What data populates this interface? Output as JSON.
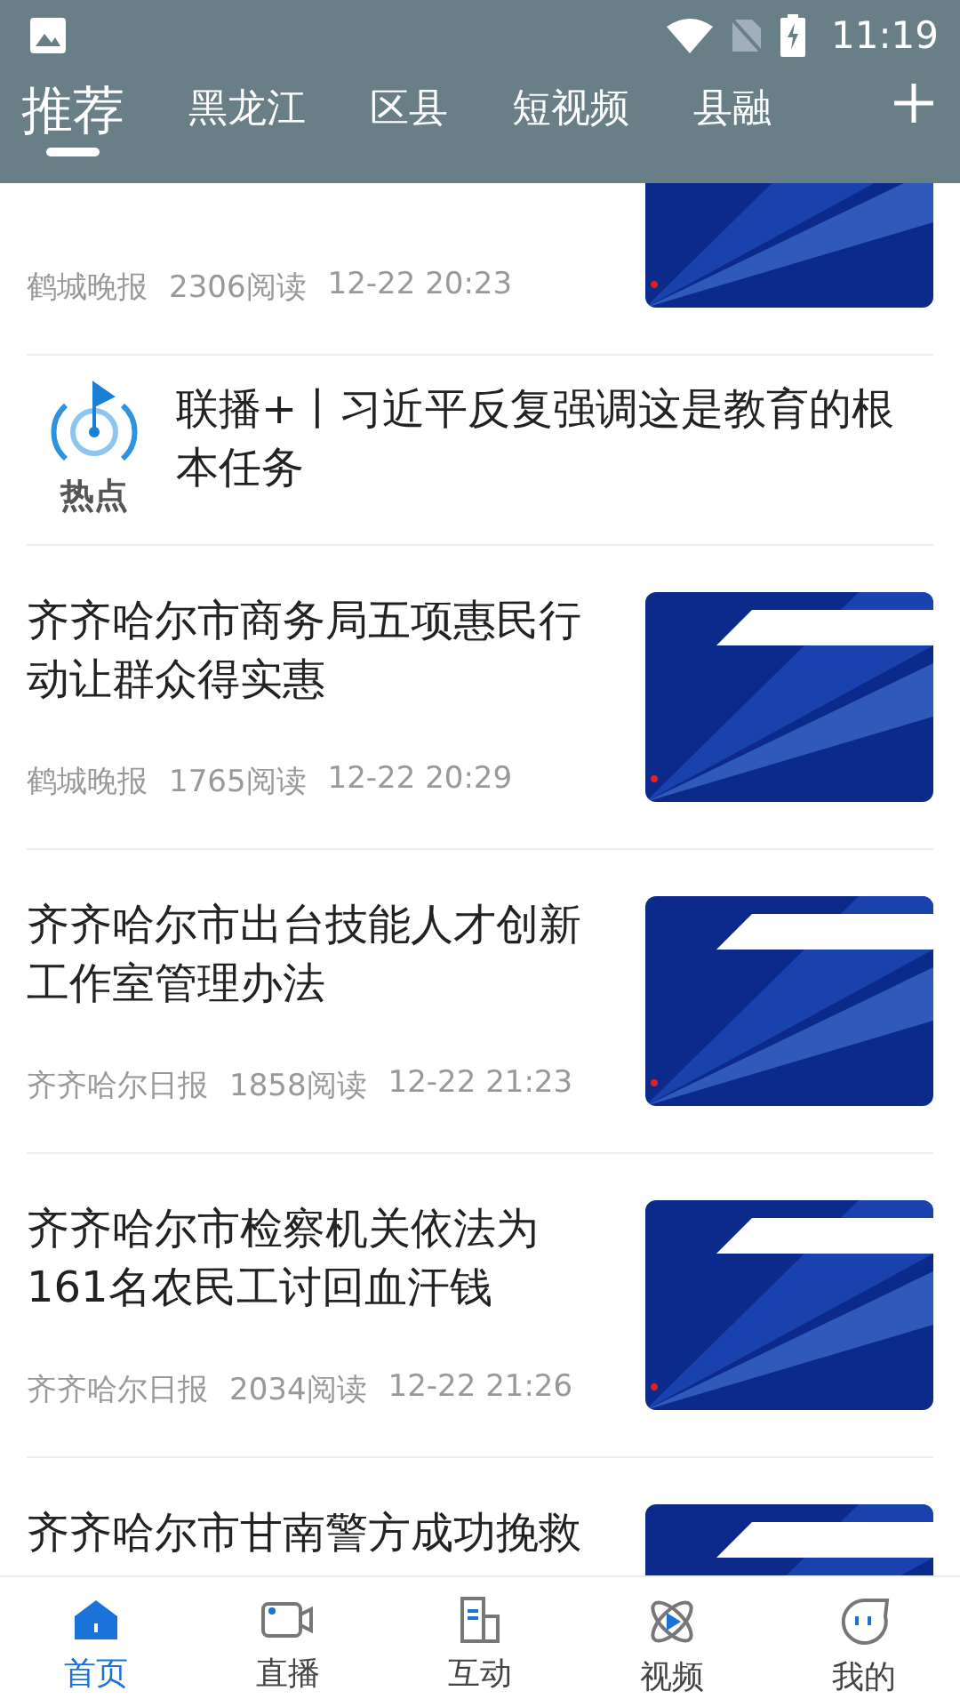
{
  "status_bar": {
    "time": "11:19"
  },
  "tabs": [
    {
      "label": "推荐",
      "selected": true
    },
    {
      "label": "黑龙江",
      "selected": false
    },
    {
      "label": "区县",
      "selected": false
    },
    {
      "label": "短视频",
      "selected": false
    },
    {
      "label": "县融",
      "selected": false
    }
  ],
  "feed": [
    {
      "kind": "thumb",
      "source": "鹤城晚报",
      "reads": "2306阅读",
      "time": "12-22 20:23"
    },
    {
      "kind": "logo",
      "title": "联播+丨习近平反复强调这是教育的根本任务",
      "logo_text": "热点"
    },
    {
      "kind": "thumb",
      "title": "齐齐哈尔市商务局五项惠民行动让群众得实惠",
      "source": "鹤城晚报",
      "reads": "1765阅读",
      "time": "12-22 20:29"
    },
    {
      "kind": "thumb",
      "title": "齐齐哈尔市出台技能人才创新工作室管理办法",
      "source": "齐齐哈尔日报",
      "reads": "1858阅读",
      "time": "12-22 21:23"
    },
    {
      "kind": "thumb",
      "title": "齐齐哈尔市检察机关依法为161名农民工讨回血汗钱",
      "source": "齐齐哈尔日报",
      "reads": "2034阅读",
      "time": "12-22 21:26"
    },
    {
      "kind": "thumb",
      "title": "齐齐哈尔市甘南警方成功挽救"
    }
  ],
  "bottom_nav": [
    {
      "label": "首页",
      "kind": "home",
      "selected": true
    },
    {
      "label": "直播",
      "kind": "camera",
      "selected": false
    },
    {
      "label": "互动",
      "kind": "doc",
      "selected": false
    },
    {
      "label": "视频",
      "kind": "orbit",
      "selected": false
    },
    {
      "label": "我的",
      "kind": "face",
      "selected": false
    }
  ]
}
